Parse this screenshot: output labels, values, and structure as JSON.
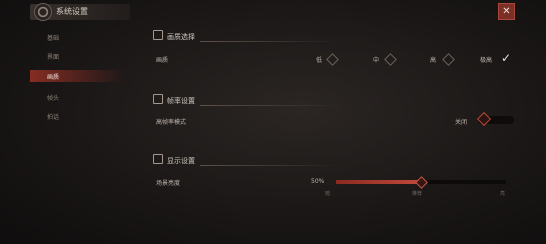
{
  "window": {
    "title": "系统设置",
    "close_glyph": "✕"
  },
  "sidebar": {
    "items": [
      {
        "label": "基础"
      },
      {
        "label": "界面"
      },
      {
        "label": "画质",
        "active": true
      },
      {
        "label": "帧头"
      },
      {
        "label": "拍话"
      }
    ]
  },
  "sections": {
    "quality": {
      "heading": "画质选择",
      "icon": "image-icon",
      "row_label": "画质",
      "options": [
        "低",
        "中",
        "高",
        "极高"
      ],
      "selected": "极高"
    },
    "framerate": {
      "heading": "帧率设置",
      "icon": "framerate-icon",
      "row_label": "高帧率模式",
      "state_label": "关闭"
    },
    "display": {
      "heading": "显示设置",
      "icon": "display-icon",
      "row_label": "场景亮度",
      "value_text": "50%",
      "value": 0.5,
      "ticks": [
        "暗",
        "推荐",
        "亮"
      ]
    }
  },
  "colors": {
    "accent": "#8a2a20",
    "close_bg": "#7b2f26"
  }
}
